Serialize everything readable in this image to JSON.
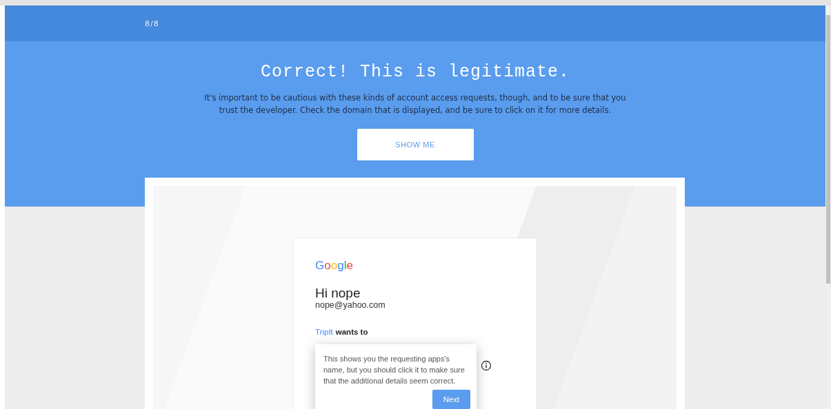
{
  "progress": "8/8",
  "result": {
    "title": "Correct! This is legitimate.",
    "message": "It's important to be cautious with these kinds of account access requests, though, and to be sure that you trust the developer. Check the domain that is displayed, and be sure to click on it for more details.",
    "button": "SHOW ME"
  },
  "login_card": {
    "logo": "Google",
    "greeting": "Hi nope",
    "email": "nope@yahoo.com",
    "app_name": "TripIt",
    "request": "wants to"
  },
  "tooltip": {
    "text": "This shows you the requesting apps's name, but you should click it to make sure that the additional details seem correct.",
    "button": "Next"
  }
}
